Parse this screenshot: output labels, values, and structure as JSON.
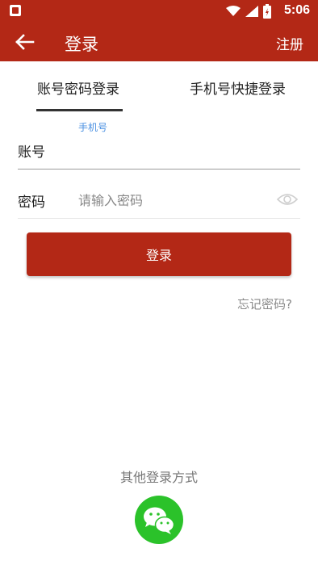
{
  "status_bar": {
    "time": "5:06",
    "icons": [
      "notification-icon",
      "wifi-icon",
      "signal-icon",
      "battery-icon"
    ]
  },
  "toolbar": {
    "title": "登录",
    "register_label": "注册",
    "back_icon": "arrow-left-icon"
  },
  "tabs": {
    "account_login": "账号密码登录",
    "phone_login": "手机号快捷登录",
    "selected": "account_login"
  },
  "form": {
    "account": {
      "label": "账号",
      "hint": "手机号",
      "value": ""
    },
    "password": {
      "label": "密码",
      "placeholder": "请输入密码",
      "value": "",
      "toggle_icon": "eye-icon"
    },
    "login_button": "登录",
    "forgot_password": "忘记密码?"
  },
  "other_login": {
    "title": "其他登录方式",
    "providers": [
      "wechat-icon"
    ]
  },
  "colors": {
    "primary": "#b32816",
    "wechat": "#2bc22a",
    "hint": "#4a90e2"
  }
}
